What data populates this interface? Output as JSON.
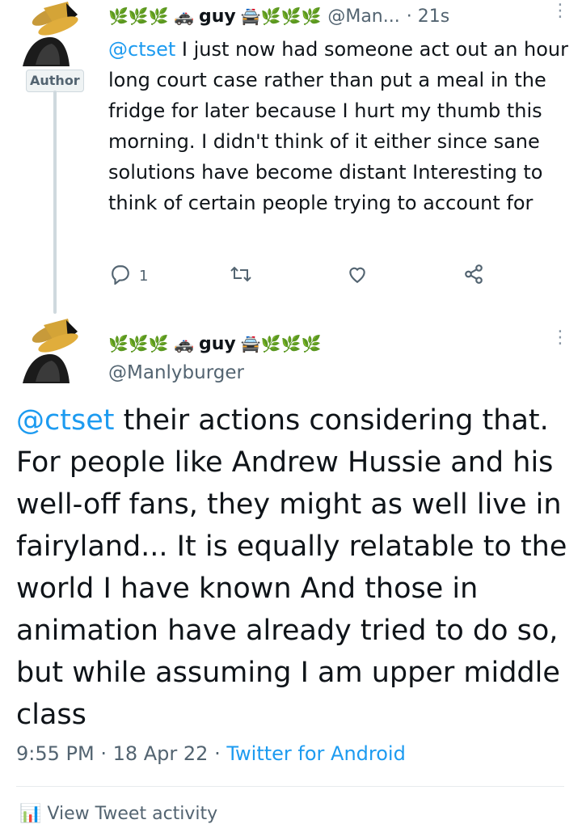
{
  "reply": {
    "display_name_prefix": "🌿🌿🌿 🚓",
    "display_name": "guy",
    "display_name_suffix": "🚔🌿🌿🌿",
    "handle": "@Man...",
    "time": "· 21s",
    "author_badge": "Author",
    "text_mention": "@ctset",
    "text_body": " I just now had someone act out an hour long court case rather than put a meal in the fridge for later because I hurt my thumb this morning. I didn't think of it either since sane solutions have become distant Interesting to think of certain people trying to account for",
    "reply_count": "1",
    "icons": [
      "reply-icon",
      "retweet-icon",
      "like-icon",
      "share-icon"
    ]
  },
  "main_tweet": {
    "display_name_prefix": "🌿🌿🌿 🚓",
    "display_name": "guy",
    "display_name_suffix": "🚔🌿🌿🌿",
    "handle": "@Manlyburger",
    "text_mention": "@ctset",
    "text_body": " their actions considering that. For people like Andrew Hussie and his well-off fans, they might as well live in fairyland... It is equally relatable to the world I have known And those in animation have already tried to do so, but while assuming I am upper middle class",
    "timestamp": "9:55 PM · 18 Apr 22 · ",
    "source": "Twitter for Android"
  },
  "footer": {
    "activity_label": "View Tweet activity"
  },
  "colors": {
    "link": "#1d9bf0",
    "muted": "#536471",
    "text": "#0f1419"
  }
}
